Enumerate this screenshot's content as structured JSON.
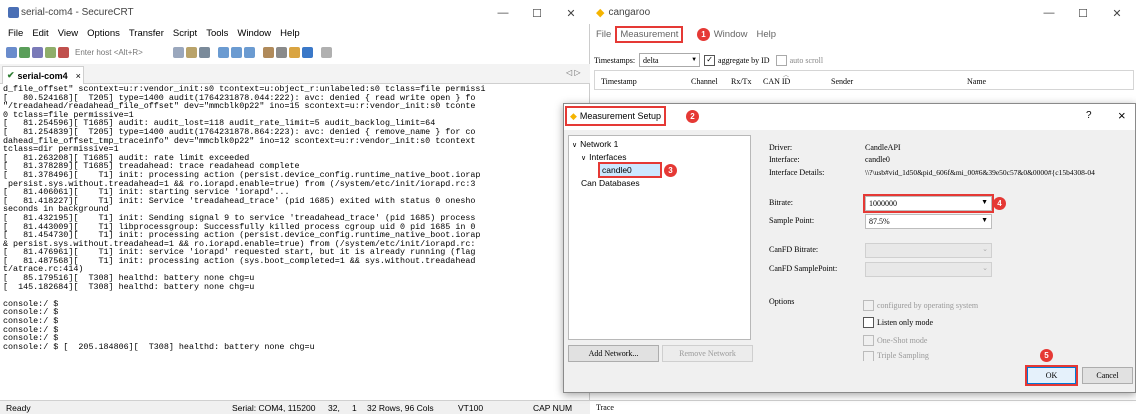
{
  "securecrt": {
    "title": "serial-com4 - SecureCRT",
    "menu": [
      "File",
      "Edit",
      "View",
      "Options",
      "Transfer",
      "Script",
      "Tools",
      "Window",
      "Help"
    ],
    "host_placeholder": "Enter host <Alt+R>",
    "tab_label": "serial-com4",
    "tab_close": "×",
    "terminal_lines": [
      "d_file_offset\" scontext=u:r:vendor_init:s0 tcontext=u:object_r:unlabeled:s0 tclass=file permissi",
      "[   80.524168][  T205] type=1400 audit(1764231878.044:222): avc: denied { read write open } fo",
      "\"/treadahead/readahead_file_offset\" dev=\"mmcblk0p22\" ino=15 scontext=u:r:vendor_init:s0 tconte",
      "0 tclass=file permissive=1",
      "[   81.254596][ T1685] audit: audit_lost=118 audit_rate_limit=5 audit_backlog_limit=64",
      "[   81.254839][  T205] type=1400 audit(1764231878.864:223): avc: denied { remove_name } for co",
      "dahead_file_offset_tmp_traceinfo\" dev=\"mmcblk0p22\" ino=12 scontext=u:r:vendor_init:s0 tcontext",
      "tclass=dir permissive=1",
      "[   81.263208][ T1685] audit: rate limit exceeded",
      "[   81.378289][ T1685] treadahead: trace readahead complete",
      "[   81.378496][    T1] init: processing action (persist.device_config.runtime_native_boot.iorap",
      " persist.sys.without.treadahead=1 && ro.iorapd.enable=true) from (/system/etc/init/iorapd.rc:3",
      "[   81.406061][    T1] init: starting service 'iorapd'...",
      "[   81.418227][    T1] init: Service 'treadahead_trace' (pid 1685) exited with status 0 onesho",
      "seconds in background",
      "[   81.432195][    T1] init: Sending signal 9 to service 'treadahead_trace' (pid 1685) process",
      "[   81.443009][    T1] libprocessgroup: Successfully killed process cgroup uid 0 pid 1685 in 0",
      "[   81.454730][    T1] init: processing action (persist.device_config.runtime_native_boot.iorap",
      "& persist.sys.without.treadahead=1 && ro.iorapd.enable=true) from (/system/etc/init/iorapd.rc:",
      "[   81.476961][    T1] init: service 'iorapd' requested start, but it is already running (flag",
      "[   81.487568][    T1] init: processing action (sys.boot_completed=1 && sys.without.treadahead",
      "t/atrace.rc:414)",
      "[   85.179516][  T308] healthd: battery none chg=u",
      "[  145.182684][  T308] healthd: battery none chg=u",
      "",
      "console:/ $",
      "console:/ $",
      "console:/ $",
      "console:/ $",
      "console:/ $",
      "console:/ $ [  205.184806][  T308] healthd: battery none chg=u"
    ],
    "status": {
      "ready": "Ready",
      "serial": "Serial: COM4, 115200",
      "row": "32,",
      "col": "1",
      "size": "32 Rows, 96 Cols",
      "term": "VT100",
      "caps": "CAP NUM"
    }
  },
  "cangaroo": {
    "title": "cangaroo",
    "menu": {
      "file": "File",
      "measurement": "Measurement",
      "trace_partial": "e",
      "window": "Window",
      "help": "Help"
    },
    "toolbar": {
      "timestamps_label": "Timestamps:",
      "timestamps_value": "delta",
      "aggregate_label": "aggregate by ID",
      "auto_scroll_label": "auto scroll"
    },
    "columns": [
      "Timestamp",
      "Channel",
      "Rx/Tx",
      "CAN ID",
      "Sender",
      "Name"
    ],
    "bottom_tab": "Trace"
  },
  "dialog": {
    "title": "Measurement Setup",
    "help_btn": "?",
    "close_btn": "×",
    "tree": {
      "network": "Network 1",
      "interfaces": "Interfaces",
      "candle": "candle0",
      "can_db": "Can Databases"
    },
    "driver_label": "Driver:",
    "driver_value": "CandleAPI",
    "interface_label": "Interface:",
    "interface_value": "candle0",
    "details_label": "Interface Details:",
    "details_value": "\\\\?\\usb#vid_1d50&pid_606f&mi_00#6&39e50c57&0&0000#{c15b4308-04",
    "bitrate_label": "Bitrate:",
    "bitrate_value": "1000000",
    "sample_point_label": "Sample Point:",
    "sample_point_value": "87.5%",
    "canfd_bitrate_label": "CanFD Bitrate:",
    "canfd_sample_label": "CanFD SamplePoint:",
    "options_label": "Options",
    "opt_configured": "configured by operating system",
    "opt_listen": "Listen only mode",
    "opt_oneshot": "One-Shot mode",
    "opt_triple": "Triple Sampling",
    "add_network": "Add Network...",
    "remove_network": "Remove Network",
    "ok": "OK",
    "cancel": "Cancel"
  },
  "badges": [
    "1",
    "2",
    "3",
    "4",
    "5"
  ],
  "colors": {
    "annotation_red": "#e53935",
    "securecrt_icon": "#4a6fb5",
    "cangaroo_icon": "#f5b400"
  }
}
